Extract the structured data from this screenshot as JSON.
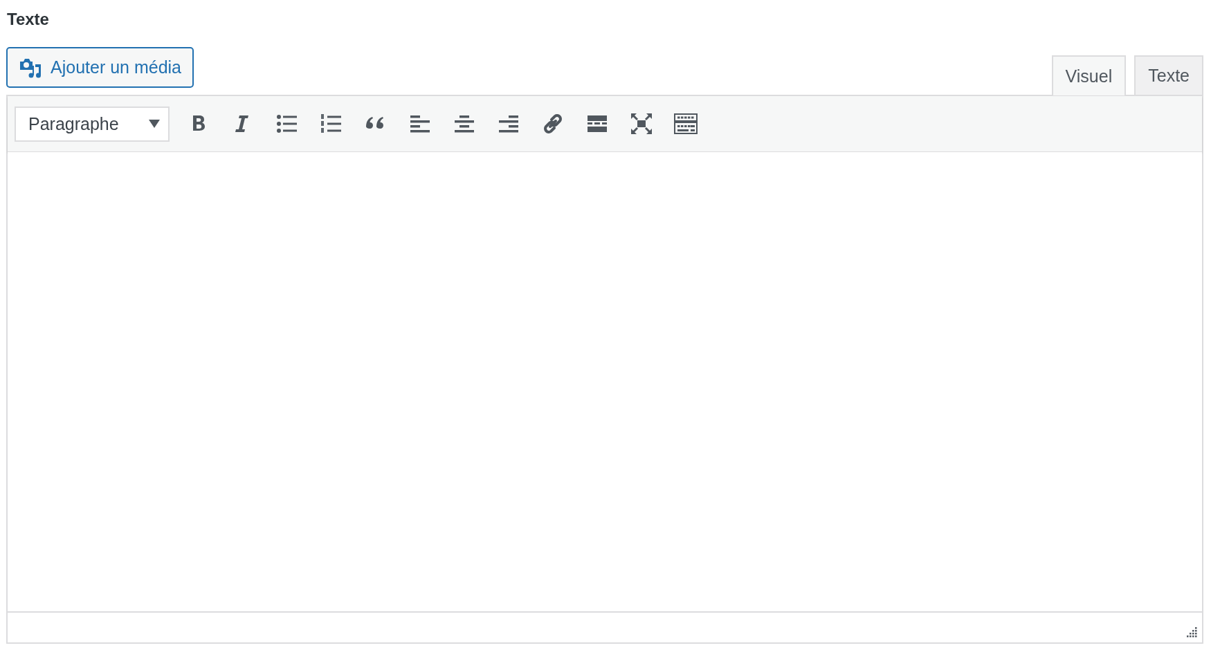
{
  "field_label": "Texte",
  "media_button": {
    "label": "Ajouter un média"
  },
  "tabs": [
    {
      "label": "Visuel",
      "selected": true
    },
    {
      "label": "Texte",
      "selected": false
    }
  ],
  "toolbar": {
    "format_select": {
      "value": "Paragraphe"
    },
    "tools": [
      {
        "kind": "bold"
      },
      {
        "kind": "italic"
      },
      {
        "kind": "bullets"
      },
      {
        "kind": "numbers"
      },
      {
        "kind": "quote"
      },
      {
        "kind": "align-left"
      },
      {
        "kind": "align-center"
      },
      {
        "kind": "align-right"
      },
      {
        "kind": "link"
      },
      {
        "kind": "more"
      },
      {
        "kind": "fullscreen"
      },
      {
        "kind": "kitchen-sink"
      }
    ]
  }
}
